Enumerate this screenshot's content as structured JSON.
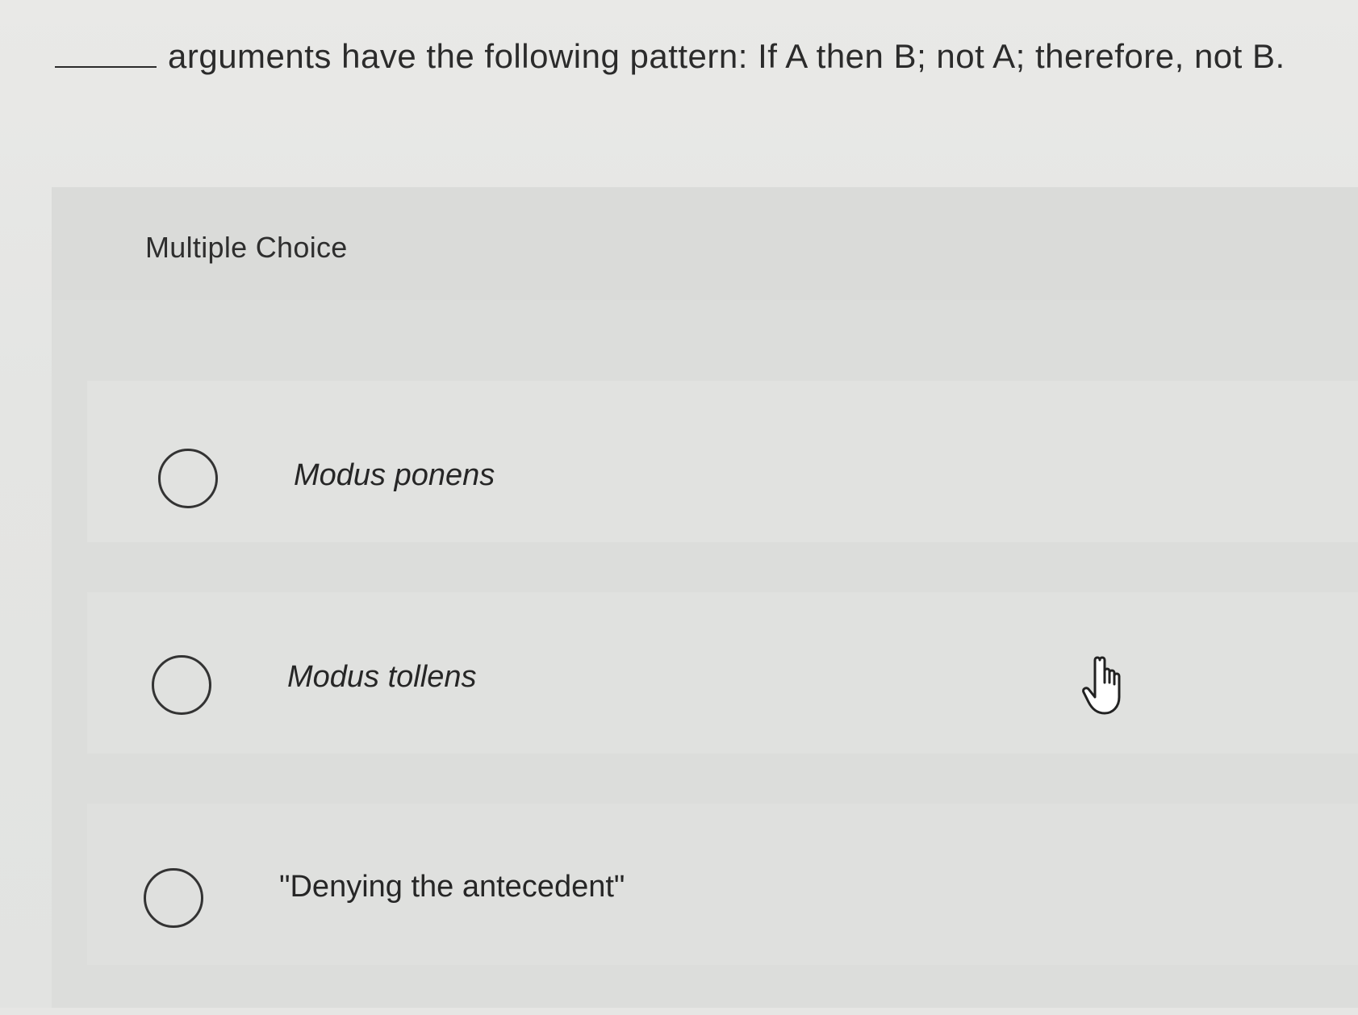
{
  "question": {
    "text": "arguments have the following pattern: If A then B; not A; therefore, not B."
  },
  "multiple_choice": {
    "title": "Multiple Choice",
    "options": [
      {
        "label": "Modus ponens",
        "selected": false
      },
      {
        "label": "Modus tollens",
        "selected": false
      },
      {
        "label": "\"Denying the antecedent\"",
        "selected": false
      }
    ]
  },
  "cursor": {
    "icon": "hand-pointer-icon"
  }
}
